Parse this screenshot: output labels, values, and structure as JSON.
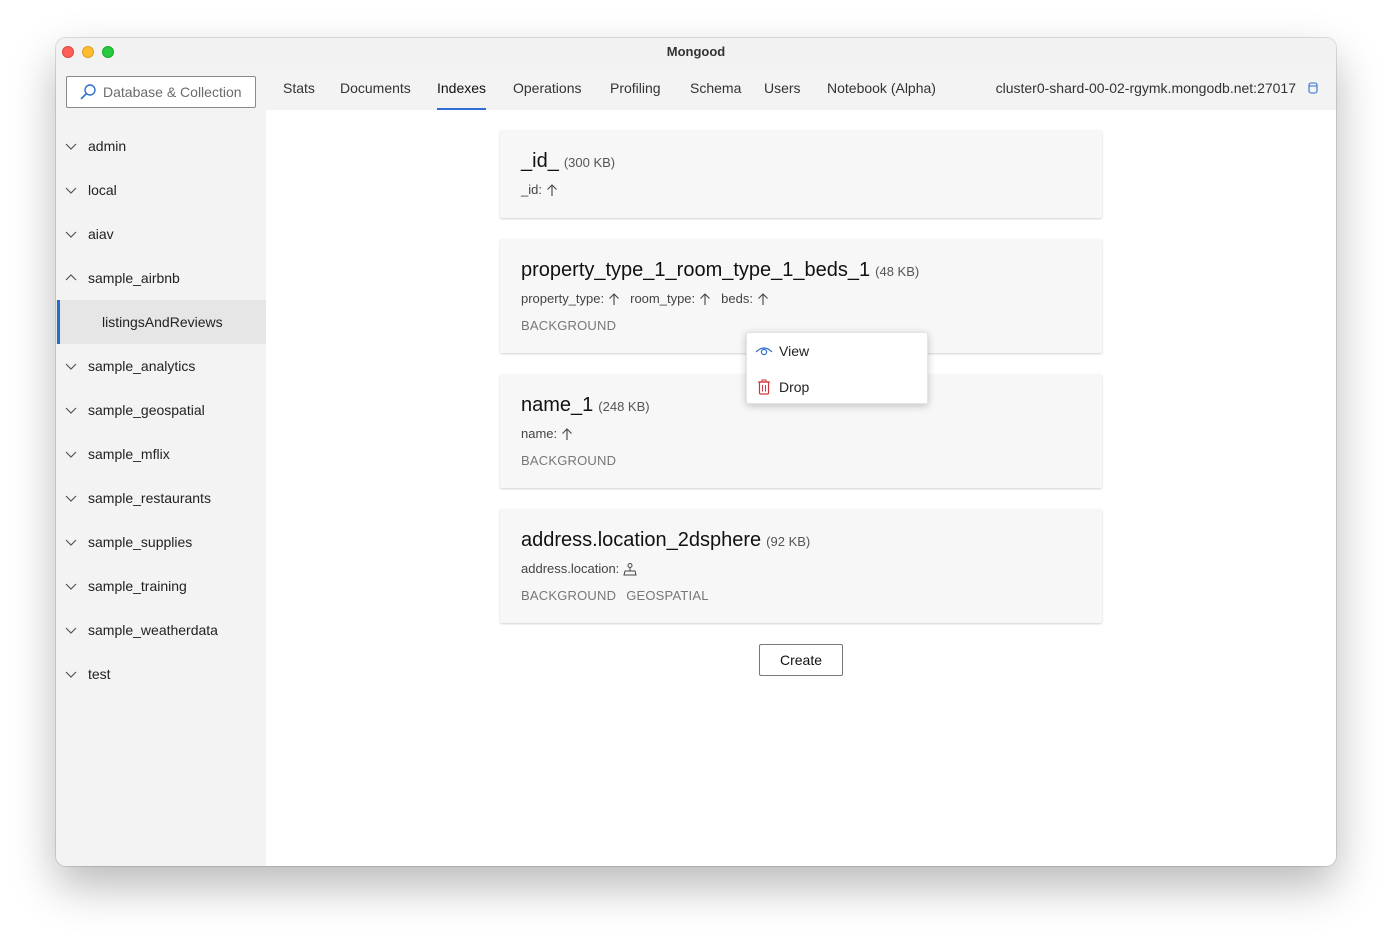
{
  "window": {
    "title": "Mongood"
  },
  "sidebar": {
    "search_placeholder": "Database & Collection",
    "databases": [
      {
        "label": "admin",
        "expanded": false
      },
      {
        "label": "local",
        "expanded": false
      },
      {
        "label": "aiav",
        "expanded": false
      },
      {
        "label": "sample_airbnb",
        "expanded": true,
        "collections": [
          "listingsAndReviews"
        ]
      },
      {
        "label": "sample_analytics",
        "expanded": false
      },
      {
        "label": "sample_geospatial",
        "expanded": false
      },
      {
        "label": "sample_mflix",
        "expanded": false
      },
      {
        "label": "sample_restaurants",
        "expanded": false
      },
      {
        "label": "sample_supplies",
        "expanded": false
      },
      {
        "label": "sample_training",
        "expanded": false
      },
      {
        "label": "sample_weatherdata",
        "expanded": false
      },
      {
        "label": "test",
        "expanded": false
      }
    ],
    "selected_collection": "listingsAndReviews"
  },
  "tabs": [
    {
      "label": "Stats"
    },
    {
      "label": "Documents"
    },
    {
      "label": "Indexes",
      "active": true
    },
    {
      "label": "Operations"
    },
    {
      "label": "Profiling"
    },
    {
      "label": "Schema"
    },
    {
      "label": "Users"
    },
    {
      "label": "Notebook (Alpha)"
    }
  ],
  "host": "cluster0-shard-00-02-rgymk.mongodb.net:27017",
  "indexes": [
    {
      "name": "_id_",
      "size": "(300 KB)",
      "keys": [
        {
          "field": "_id:",
          "icon": "arrow-up-icon"
        }
      ],
      "flags": []
    },
    {
      "name": "property_type_1_room_type_1_beds_1",
      "size": "(48 KB)",
      "keys": [
        {
          "field": "property_type:",
          "icon": "arrow-up-icon"
        },
        {
          "field": "room_type:",
          "icon": "arrow-up-icon"
        },
        {
          "field": "beds:",
          "icon": "arrow-up-icon"
        }
      ],
      "flags": [
        "BACKGROUND"
      ]
    },
    {
      "name": "name_1",
      "size": "(248 KB)",
      "keys": [
        {
          "field": "name:",
          "icon": "arrow-up-icon"
        }
      ],
      "flags": [
        "BACKGROUND"
      ]
    },
    {
      "name": "address.location_2dsphere",
      "size": "(92 KB)",
      "keys": [
        {
          "field": "address.location:",
          "icon": "geospatial-icon"
        }
      ],
      "flags": [
        "BACKGROUND",
        "GEOSPATIAL"
      ]
    }
  ],
  "create_label": "Create",
  "context_menu": {
    "items": [
      {
        "label": "View",
        "icon": "eye-icon",
        "color": "#2f6fd1"
      },
      {
        "label": "Drop",
        "icon": "trash-icon",
        "color": "#d13438"
      }
    ]
  },
  "colors": {
    "accent": "#2f6fd1",
    "danger": "#d13438"
  }
}
